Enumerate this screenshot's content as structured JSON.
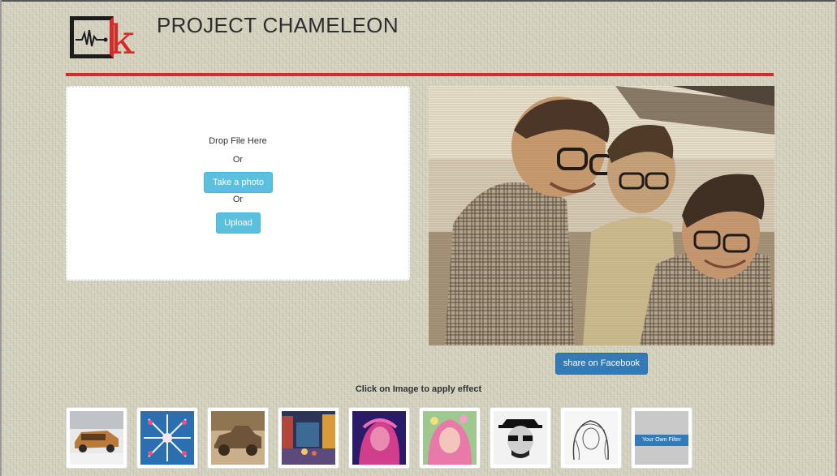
{
  "header": {
    "title": "PROJECT CHAMELEON",
    "logo_letter": "k",
    "accent_color": "#d52b2b"
  },
  "dropzone": {
    "drop_text": "Drop File Here",
    "or_1": "Or",
    "take_photo_label": "Take a photo",
    "or_2": "Or",
    "upload_label": "Upload"
  },
  "preview": {
    "share_label": "share on Facebook"
  },
  "filters": {
    "instruction": "Click on Image to apply effect",
    "own_filter_label": "Your Own Filter",
    "items": [
      {
        "name": "filter-thumb-car"
      },
      {
        "name": "filter-thumb-kaleidoscope"
      },
      {
        "name": "filter-thumb-vintage-car"
      },
      {
        "name": "filter-thumb-city-street"
      },
      {
        "name": "filter-thumb-purple-portrait"
      },
      {
        "name": "filter-thumb-pink-portrait"
      },
      {
        "name": "filter-thumb-heisenberg"
      },
      {
        "name": "filter-thumb-sketch"
      },
      {
        "name": "filter-thumb-own-filter"
      }
    ]
  },
  "colors": {
    "info": "#5bc0de",
    "primary": "#337ab7",
    "background": "#d5d2c0"
  }
}
